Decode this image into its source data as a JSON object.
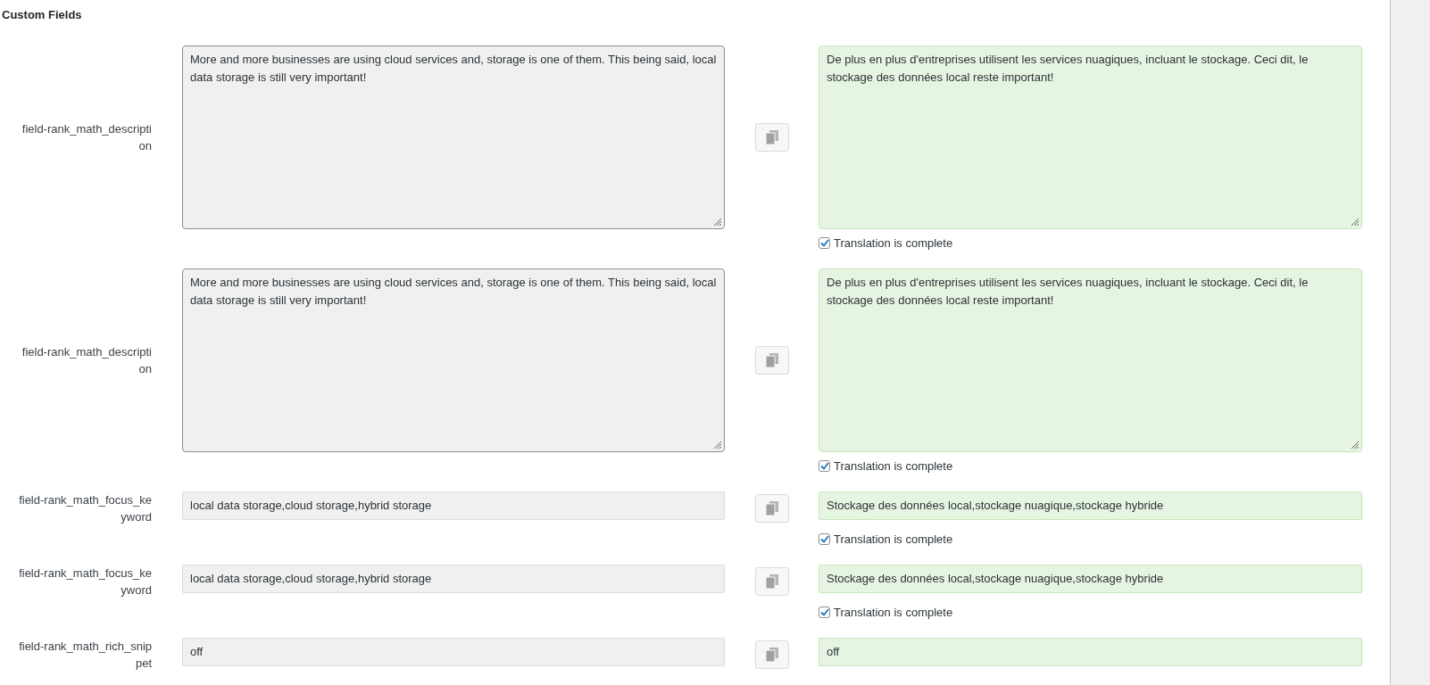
{
  "section_title": "Custom Fields",
  "fields": [
    {
      "kind": "textarea",
      "label": "field-rank_math_description",
      "source": "More and more businesses are using cloud services and, storage is one of them. This being said, local data storage is still very important!",
      "translation": "De plus en plus d'entreprises utilisent les services nuagiques, incluant le stockage. Ceci dit, le stockage des données local reste important!",
      "complete": {
        "label": "Translation is complete",
        "checked": true
      }
    },
    {
      "kind": "textarea",
      "label": "field-rank_math_description",
      "source": "More and more businesses are using cloud services and, storage is one of them. This being said, local data storage is still very important!",
      "translation": "De plus en plus d'entreprises utilisent les services nuagiques, incluant le stockage. Ceci dit, le stockage des données local reste important!",
      "complete": {
        "label": "Translation is complete",
        "checked": true
      }
    },
    {
      "kind": "input",
      "label": "field-rank_math_focus_keyword",
      "source": "local data storage,cloud storage,hybrid storage",
      "translation": "Stockage des données local,stockage nuagique,stockage hybride",
      "complete": {
        "label": "Translation is complete",
        "checked": true
      }
    },
    {
      "kind": "input",
      "label": "field-rank_math_focus_keyword",
      "source": "local data storage,cloud storage,hybrid storage",
      "translation": "Stockage des données local,stockage nuagique,stockage hybride",
      "complete": {
        "label": "Translation is complete",
        "checked": true
      }
    },
    {
      "kind": "input",
      "label": "field-rank_math_rich_snippet",
      "source": "off",
      "translation": "off"
    }
  ]
}
